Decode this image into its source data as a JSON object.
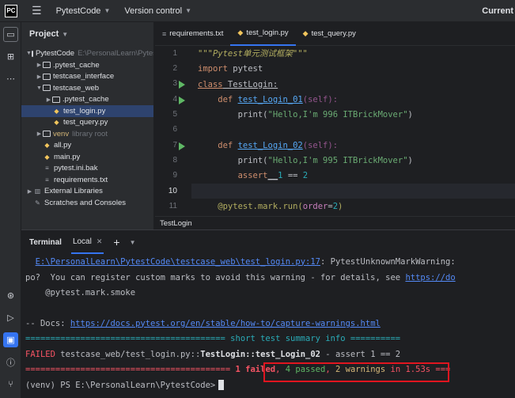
{
  "titlebar": {
    "project_name": "PytestCode",
    "vcs_label": "Version control",
    "right_label": "Current"
  },
  "project_panel": {
    "title": "Project",
    "tree": [
      {
        "label": "PytestCode",
        "extra": "E:\\PersonalLearn\\PytestCode",
        "icon": "folder-icon",
        "level": 0,
        "arrow": "down"
      },
      {
        "label": ".pytest_cache",
        "icon": "folder-icon",
        "level": 1,
        "arrow": "right"
      },
      {
        "label": "testcase_interface",
        "icon": "folder-icon",
        "level": 1,
        "arrow": "right"
      },
      {
        "label": "testcase_web",
        "icon": "folder-icon",
        "level": 1,
        "arrow": "down"
      },
      {
        "label": ".pytest_cache",
        "icon": "folder-icon",
        "level": 2,
        "arrow": "right"
      },
      {
        "label": "test_login.py",
        "icon": "python-file-icon",
        "level": 2,
        "arrow": "",
        "selected": true
      },
      {
        "label": "test_query.py",
        "icon": "python-file-icon",
        "level": 2,
        "arrow": ""
      },
      {
        "label": "venv",
        "extra": "library root",
        "icon": "folder-icon",
        "level": 1,
        "arrow": "right"
      },
      {
        "label": "all.py",
        "icon": "python-file-icon",
        "level": 1,
        "arrow": ""
      },
      {
        "label": "main.py",
        "icon": "python-file-icon",
        "level": 1,
        "arrow": ""
      },
      {
        "label": "pytest.ini.bak",
        "icon": "text-file-icon",
        "level": 1,
        "arrow": ""
      },
      {
        "label": "requirements.txt",
        "icon": "text-file-icon",
        "level": 1,
        "arrow": ""
      },
      {
        "label": "External Libraries",
        "icon": "library-icon",
        "level": 0,
        "arrow": "right"
      },
      {
        "label": "Scratches and Consoles",
        "icon": "scratches-icon",
        "level": 0,
        "arrow": ""
      }
    ]
  },
  "editor": {
    "tabs": [
      {
        "label": "requirements.txt",
        "icon": "text-file-icon",
        "active": false
      },
      {
        "label": "test_login.py",
        "icon": "python-file-icon",
        "active": true
      },
      {
        "label": "test_query.py",
        "icon": "python-file-icon",
        "active": false
      }
    ],
    "line_numbers": [
      "1",
      "2",
      "3",
      "4",
      "5",
      "6",
      "7",
      "8",
      "9",
      "10",
      "11"
    ],
    "code": {
      "l1": "\"\"\"Pytest单元测试框架\"\"\"",
      "l2_kw": "import",
      "l2_rest": " pytest",
      "l3_kw": "class",
      "l3_name": " TestLogin:",
      "l4_kw": "    def ",
      "l4_fn": "test_Login_01",
      "l4_rest": "(self):",
      "l5_fn": "        print(",
      "l5_str": "\"Hello,I'm 996 ITBrickMover\"",
      "l5_end": ")",
      "l7_kw": "    def ",
      "l7_fn": "test_Login_02",
      "l7_rest": "(self):",
      "l8_fn": "        print(",
      "l8_str": "\"Hello,I'm 995 ITBrickMover\"",
      "l8_end": ")",
      "l9_kw": "        assert",
      "l9_a": "__",
      "l9_b": "1",
      "l9_op": " == ",
      "l9_c": "2",
      "l11_dec": "    @pytest.mark.run(",
      "l11_param": "order",
      "l11_eq": "=",
      "l11_val": "2",
      "l11_end": ")"
    },
    "breadcrumb": "TestLogin"
  },
  "terminal": {
    "title": "Terminal",
    "tab_label": "Local",
    "lines": {
      "w1_path": "E:\\PersonalLearn\\PytestCode\\testcase_web\\test_login.py:17",
      "w1_rest": ": PytestUnknownMarkWarning:",
      "w2_text": "po?  You can register custom marks to avoid this warning - for details, see ",
      "w2_link": "https://do",
      "w3": "    @pytest.mark.smoke",
      "docs_label": "-- Docs: ",
      "docs_link": "https://docs.pytest.org/en/stable/how-to/capture-warnings.html",
      "summary": "======================================== short test summary info ==========",
      "failed_label": "FAILED",
      "failed_path": " testcase_web/test_login.py::",
      "failed_test": "TestLogin::test_Login_02",
      "failed_rest": " - assert 1 == 2",
      "result_eq": "========================================= ",
      "result_failed": "1 failed",
      "result_sep1": ", ",
      "result_passed": "4 passed",
      "result_sep2": ", ",
      "result_warn": "2 warnings",
      "result_time": " in 1.53s ===",
      "prompt": "(venv) PS E:\\PersonalLearn\\PytestCode>"
    }
  },
  "toolstrip": {
    "icons": [
      "project-folder-icon",
      "structure-icon",
      "more-icon",
      "services-icon",
      "run-icon",
      "terminal-icon",
      "problems-icon",
      "git-icon"
    ]
  }
}
